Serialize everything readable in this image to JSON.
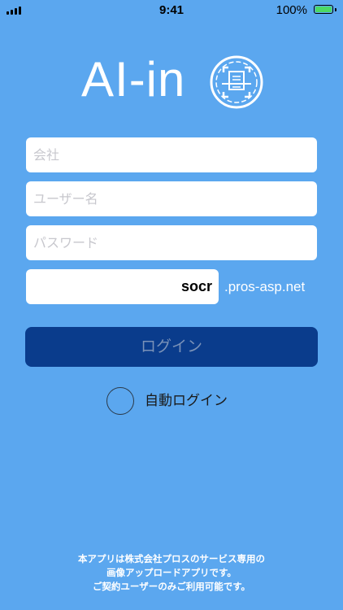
{
  "status_bar": {
    "time": "9:41",
    "battery_percent": "100%",
    "battery_color": "#4cd964"
  },
  "logo": {
    "text": "AI-in",
    "icon": "scanner-logo-icon"
  },
  "form": {
    "company_placeholder": "会社",
    "username_placeholder": "ユーザー名",
    "password_placeholder": "パスワード",
    "domain_value": "socr",
    "domain_suffix": ".pros-asp.net"
  },
  "login_button": {
    "label": "ログイン",
    "color": "#0a3c8c"
  },
  "auto_login": {
    "label": "自動ログイン",
    "checked": false
  },
  "footer": {
    "lines": [
      "本アプリは株式会社プロスのサービス専用の",
      "画像アップロードアプリです。",
      "ご契約ユーザーのみご利用可能です。"
    ]
  },
  "colors": {
    "background": "#5ba7ef",
    "button": "#0a3c8c"
  }
}
